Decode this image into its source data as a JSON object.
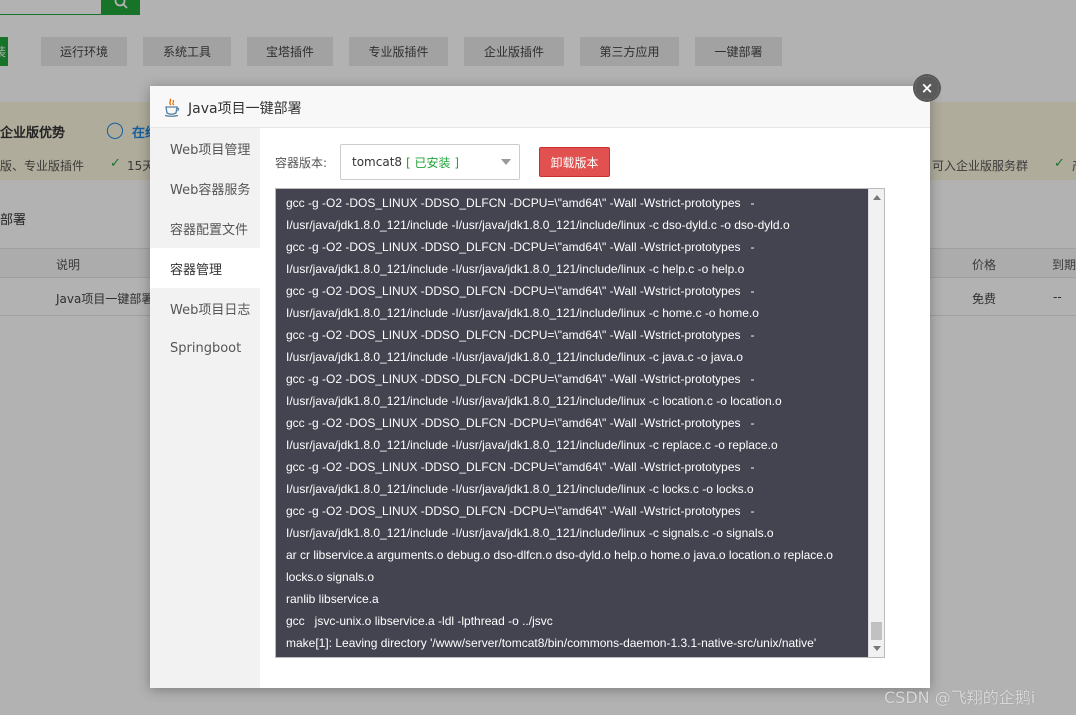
{
  "background": {
    "tabs": [
      {
        "label": "装",
        "active": true
      },
      {
        "label": "运行环境"
      },
      {
        "label": "系统工具"
      },
      {
        "label": "宝塔插件"
      },
      {
        "label": "专业版插件"
      },
      {
        "label": "企业版插件"
      },
      {
        "label": "第三方应用"
      },
      {
        "label": "一键部署"
      }
    ],
    "promo": {
      "title": "企业版优势",
      "online": "在线",
      "sub": "版、专业版插件",
      "days": "15天",
      "right": "可入企业版服务群",
      "right2": "产"
    },
    "section_title": "部署",
    "table": {
      "headers": [
        "说明",
        "价格",
        "到期"
      ],
      "row": {
        "desc": "Java项目一键部署",
        "price": "免费",
        "expire": "--"
      }
    }
  },
  "modal": {
    "title": "Java项目一键部署",
    "close_label": "×",
    "sidebar": [
      {
        "label": "Web项目管理"
      },
      {
        "label": "Web容器服务"
      },
      {
        "label": "容器配置文件"
      },
      {
        "label": "容器管理",
        "active": true
      },
      {
        "label": "Web项目日志"
      },
      {
        "label": "Springboot"
      }
    ],
    "container": {
      "version_label": "容器版本:",
      "selected_version": "tomcat8",
      "selected_status": "[ 已安装 ]",
      "uninstall_label": "卸载版本"
    },
    "console_lines": [
      "gcc -g -O2 -DOS_LINUX -DDSO_DLFCN -DCPU=\\\"amd64\\\" -Wall -Wstrict-prototypes   -",
      "I/usr/java/jdk1.8.0_121/include -I/usr/java/jdk1.8.0_121/include/linux -c dso-dyld.c -o dso-dyld.o",
      "gcc -g -O2 -DOS_LINUX -DDSO_DLFCN -DCPU=\\\"amd64\\\" -Wall -Wstrict-prototypes   -",
      "I/usr/java/jdk1.8.0_121/include -I/usr/java/jdk1.8.0_121/include/linux -c help.c -o help.o",
      "gcc -g -O2 -DOS_LINUX -DDSO_DLFCN -DCPU=\\\"amd64\\\" -Wall -Wstrict-prototypes   -",
      "I/usr/java/jdk1.8.0_121/include -I/usr/java/jdk1.8.0_121/include/linux -c home.c -o home.o",
      "gcc -g -O2 -DOS_LINUX -DDSO_DLFCN -DCPU=\\\"amd64\\\" -Wall -Wstrict-prototypes   -",
      "I/usr/java/jdk1.8.0_121/include -I/usr/java/jdk1.8.0_121/include/linux -c java.c -o java.o",
      "gcc -g -O2 -DOS_LINUX -DDSO_DLFCN -DCPU=\\\"amd64\\\" -Wall -Wstrict-prototypes   -",
      "I/usr/java/jdk1.8.0_121/include -I/usr/java/jdk1.8.0_121/include/linux -c location.c -o location.o",
      "gcc -g -O2 -DOS_LINUX -DDSO_DLFCN -DCPU=\\\"amd64\\\" -Wall -Wstrict-prototypes   -",
      "I/usr/java/jdk1.8.0_121/include -I/usr/java/jdk1.8.0_121/include/linux -c replace.c -o replace.o",
      "gcc -g -O2 -DOS_LINUX -DDSO_DLFCN -DCPU=\\\"amd64\\\" -Wall -Wstrict-prototypes   -",
      "I/usr/java/jdk1.8.0_121/include -I/usr/java/jdk1.8.0_121/include/linux -c locks.c -o locks.o",
      "gcc -g -O2 -DOS_LINUX -DDSO_DLFCN -DCPU=\\\"amd64\\\" -Wall -Wstrict-prototypes   -",
      "I/usr/java/jdk1.8.0_121/include -I/usr/java/jdk1.8.0_121/include/linux -c signals.c -o signals.o",
      "ar cr libservice.a arguments.o debug.o dso-dlfcn.o dso-dyld.o help.o home.o java.o location.o replace.o",
      "locks.o signals.o",
      "ranlib libservice.a",
      "gcc   jsvc-unix.o libservice.a -ldl -lpthread -o ../jsvc",
      "make[1]: Leaving directory '/www/server/tomcat8/bin/commons-daemon-1.3.1-native-src/unix/native'"
    ]
  },
  "watermark": "CSDN @飞翔的企鹅i"
}
